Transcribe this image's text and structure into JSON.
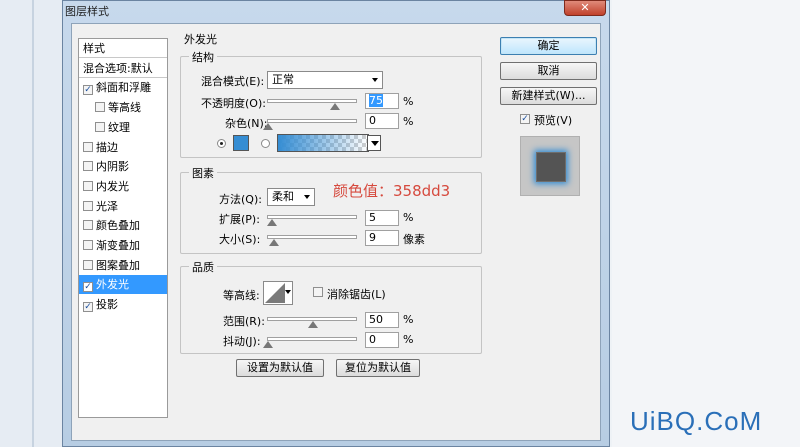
{
  "window": {
    "title": "图层样式",
    "close_glyph": "✕"
  },
  "styles_list": [
    {
      "label": "样式",
      "checkbox": false,
      "indent": 0,
      "separator": true
    },
    {
      "label": "混合选项:默认",
      "checkbox": false,
      "indent": 0,
      "separator": true
    },
    {
      "label": "斜面和浮雕",
      "checkbox": true,
      "checked": true,
      "indent": 0
    },
    {
      "label": "等高线",
      "checkbox": true,
      "checked": false,
      "indent": 1
    },
    {
      "label": "纹理",
      "checkbox": true,
      "checked": false,
      "indent": 1
    },
    {
      "label": "描边",
      "checkbox": true,
      "checked": false,
      "indent": 0
    },
    {
      "label": "内阴影",
      "checkbox": true,
      "checked": false,
      "indent": 0
    },
    {
      "label": "内发光",
      "checkbox": true,
      "checked": false,
      "indent": 0
    },
    {
      "label": "光泽",
      "checkbox": true,
      "checked": false,
      "indent": 0
    },
    {
      "label": "颜色叠加",
      "checkbox": true,
      "checked": false,
      "indent": 0
    },
    {
      "label": "渐变叠加",
      "checkbox": true,
      "checked": false,
      "indent": 0
    },
    {
      "label": "图案叠加",
      "checkbox": true,
      "checked": false,
      "indent": 0
    },
    {
      "label": "外发光",
      "checkbox": true,
      "checked": true,
      "indent": 0,
      "selected": true
    },
    {
      "label": "投影",
      "checkbox": true,
      "checked": true,
      "indent": 0
    }
  ],
  "panel": {
    "title": "外发光",
    "structure": {
      "title": "结构",
      "blend_mode_label": "混合模式(E):",
      "blend_mode_value": "正常",
      "opacity_label": "不透明度(O):",
      "opacity_value": "75",
      "opacity_unit": "%",
      "noise_label": "杂色(N):",
      "noise_value": "0",
      "noise_unit": "%",
      "color_hex": "#358dd3"
    },
    "elements": {
      "title": "图素",
      "technique_label": "方法(Q):",
      "technique_value": "柔和",
      "spread_label": "扩展(P):",
      "spread_value": "5",
      "spread_unit": "%",
      "size_label": "大小(S):",
      "size_value": "9",
      "size_unit": "像素"
    },
    "annotation": "颜色值：358dd3",
    "quality": {
      "title": "品质",
      "contour_label": "等高线:",
      "antialias_label": "消除锯齿(L)",
      "range_label": "范围(R):",
      "range_value": "50",
      "range_unit": "%",
      "jitter_label": "抖动(J):",
      "jitter_value": "0",
      "jitter_unit": "%"
    },
    "make_default_label": "设置为默认值",
    "reset_default_label": "复位为默认值"
  },
  "buttons": {
    "ok": "确定",
    "cancel": "取消",
    "new_style": "新建样式(W)...",
    "preview_label": "预览(V)"
  },
  "watermark": "UiBQ.CoM"
}
